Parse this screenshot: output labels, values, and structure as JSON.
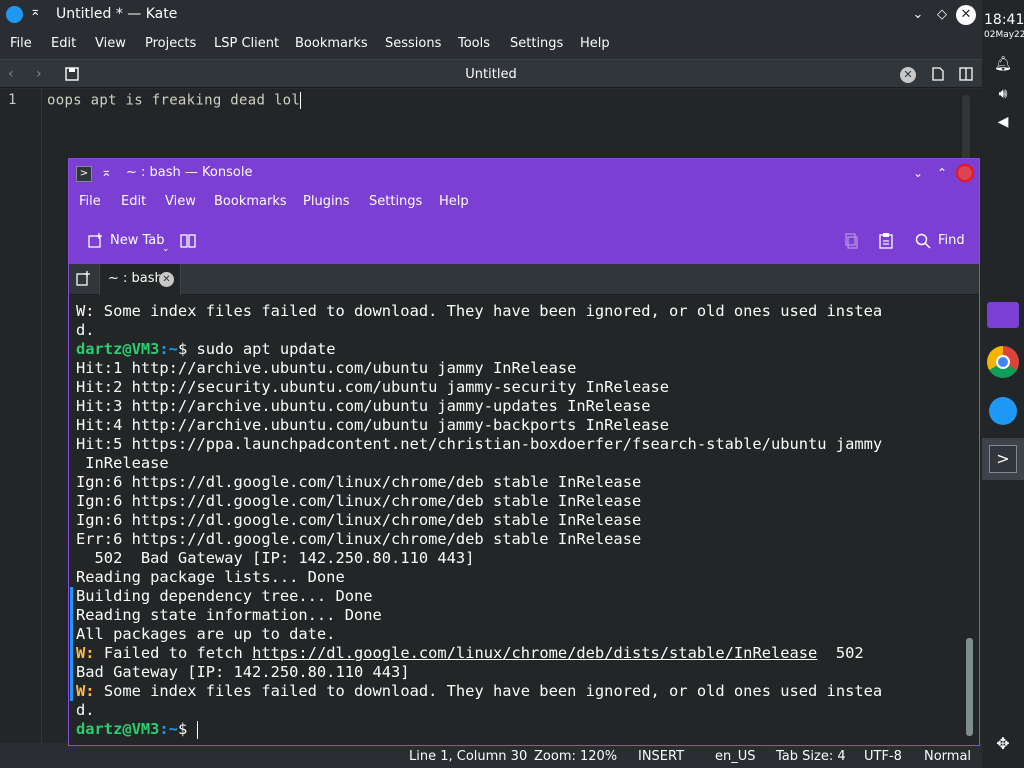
{
  "kate": {
    "window_title": "Untitled * — Kate",
    "menu": [
      "File",
      "Edit",
      "View",
      "Projects",
      "LSP Client",
      "Bookmarks",
      "Sessions",
      "Tools",
      "Settings",
      "Help"
    ],
    "tab_title": "Untitled",
    "editor": {
      "line_number": "1",
      "line_text": "oops apt is freaking dead lol"
    },
    "status": {
      "position": "Line 1, Column 30",
      "zoom": "Zoom: 120%",
      "mode": "INSERT",
      "language": "en_US",
      "tab_size": "Tab Size: 4",
      "encoding": "UTF-8",
      "input_mode": "Normal"
    }
  },
  "konsole": {
    "window_title": "~ : bash — Konsole",
    "menu": [
      "File",
      "Edit",
      "View",
      "Bookmarks",
      "Plugins",
      "Settings",
      "Help"
    ],
    "toolbar": {
      "new_tab": "New Tab",
      "find": "Find"
    },
    "tab_label": "~ : bash",
    "colors": {
      "accent": "#7b3fd3",
      "prompt_green": "#2ecc71",
      "prompt_blue": "#1d99f3",
      "warning_yellow": "#fdbc4b"
    },
    "terminal": {
      "l1": "W: Some index files failed to download. They have been ignored, or old ones used instea",
      "l2": "d.",
      "prompt_user": "dartz@VM3",
      "prompt_path": ":~",
      "prompt_symbol": "$",
      "cmd": " sudo apt update",
      "l4": "Hit:1 http://archive.ubuntu.com/ubuntu jammy InRelease",
      "l5": "Hit:2 http://security.ubuntu.com/ubuntu jammy-security InRelease",
      "l6": "Hit:3 http://archive.ubuntu.com/ubuntu jammy-updates InRelease",
      "l7": "Hit:4 http://archive.ubuntu.com/ubuntu jammy-backports InRelease",
      "l8": "Hit:5 https://ppa.launchpadcontent.net/christian-boxdoerfer/fsearch-stable/ubuntu jammy",
      "l9": " InRelease",
      "l10": "Ign:6 https://dl.google.com/linux/chrome/deb stable InRelease",
      "l11": "Ign:6 https://dl.google.com/linux/chrome/deb stable InRelease",
      "l12": "Ign:6 https://dl.google.com/linux/chrome/deb stable InRelease",
      "l13": "Err:6 https://dl.google.com/linux/chrome/deb stable InRelease",
      "l14": "  502  Bad Gateway [IP: 142.250.80.110 443]",
      "l15": "Reading package lists... Done",
      "l16": "Building dependency tree... Done",
      "l17": "Reading state information... Done",
      "l18": "All packages are up to date.",
      "w_prefix": "W:",
      "l19_a": " Failed to fetch ",
      "l19_link": "https://dl.google.com/linux/chrome/deb/dists/stable/InRelease",
      "l19_b": "  502",
      "l20": "Bad Gateway [IP: 142.250.80.110 443]",
      "l21": " Some index files failed to download. They have been ignored, or old ones used instea",
      "l22": "d."
    }
  },
  "panel": {
    "time": "18:41",
    "date": "02May22"
  }
}
